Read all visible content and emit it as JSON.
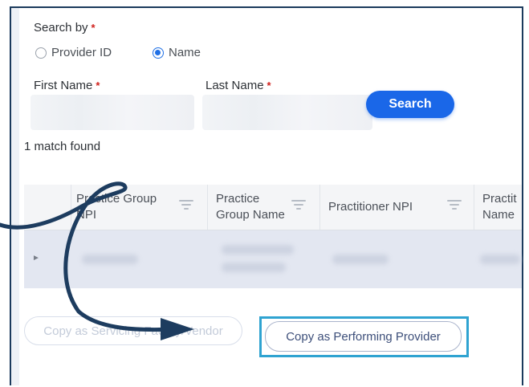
{
  "search_by": {
    "label": "Search by",
    "required_mark": "*"
  },
  "radio_options": [
    {
      "label": "Provider ID",
      "selected": false
    },
    {
      "label": "Name",
      "selected": true
    }
  ],
  "first_name": {
    "label": "First Name",
    "required_mark": "*"
  },
  "last_name": {
    "label": "Last Name",
    "required_mark": "*"
  },
  "search_button": {
    "label": "Search"
  },
  "results": {
    "match_text": "1  match found"
  },
  "table": {
    "columns": [
      "Practice Group NPI",
      "Practice Group Name",
      "Practitioner NPI",
      "Practit Name"
    ]
  },
  "actions": {
    "copy_servicing": "Copy as Servicing Facility/Vendor",
    "copy_performing": "Copy as Performing Provider"
  },
  "colors": {
    "accent": "#1a67e8",
    "highlight": "#2fa3d1",
    "annotation_arrow": "#1d3c5f",
    "required": "#d0211c"
  }
}
